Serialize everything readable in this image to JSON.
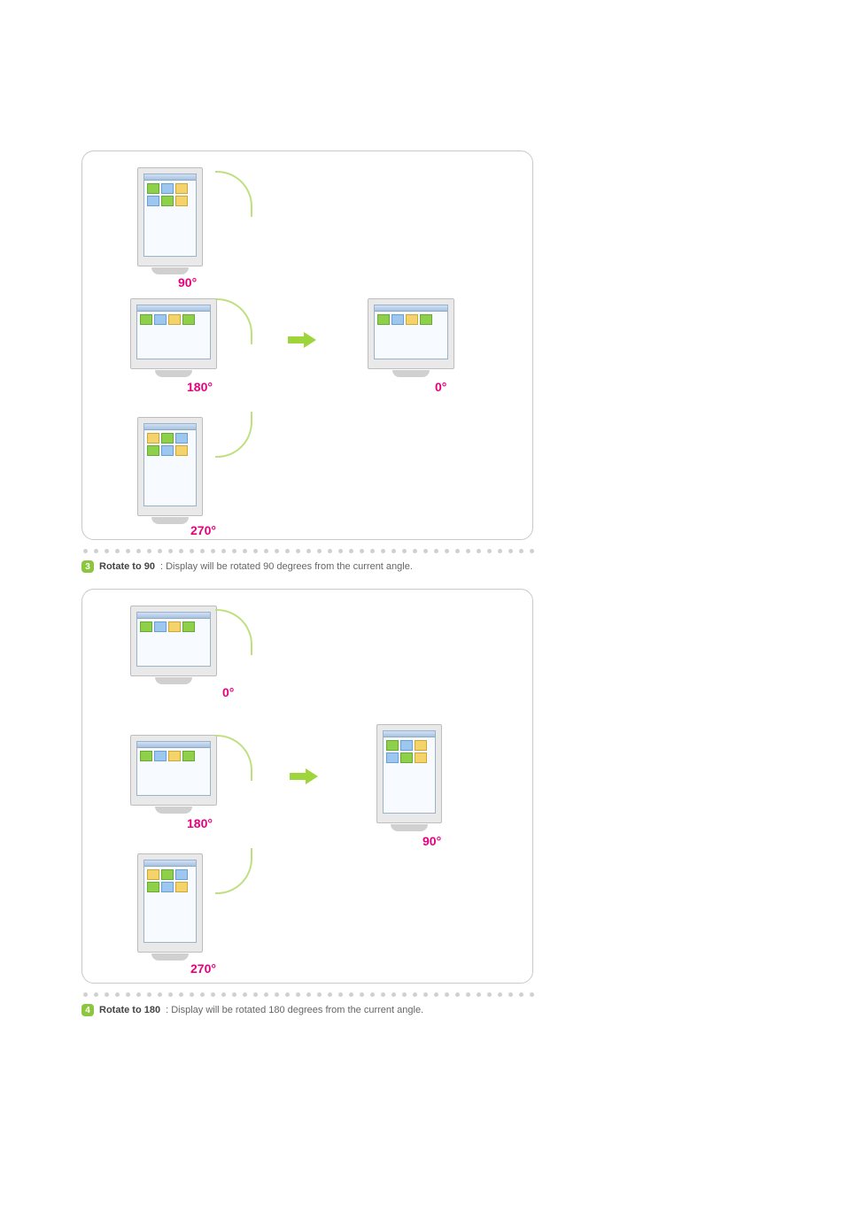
{
  "nums": {
    "n3": "3",
    "n4": "4"
  },
  "step3": {
    "title": "Rotate to 90",
    "desc": " : Display will be rotated 90 degrees from the current angle."
  },
  "step4": {
    "title": "Rotate to 180",
    "desc": " : Display will be rotated 180 degrees from the current angle."
  },
  "angles": {
    "a90": "90°",
    "a180": "180°",
    "a270": "270°",
    "a0": "0°"
  },
  "panelA": {
    "labels": {
      "top": "a90",
      "mid": "a180",
      "bot": "a270",
      "res": "a0"
    }
  },
  "panelB": {
    "labels": {
      "top": "a0",
      "mid": "a180",
      "bot": "a270",
      "res": "a90"
    }
  }
}
